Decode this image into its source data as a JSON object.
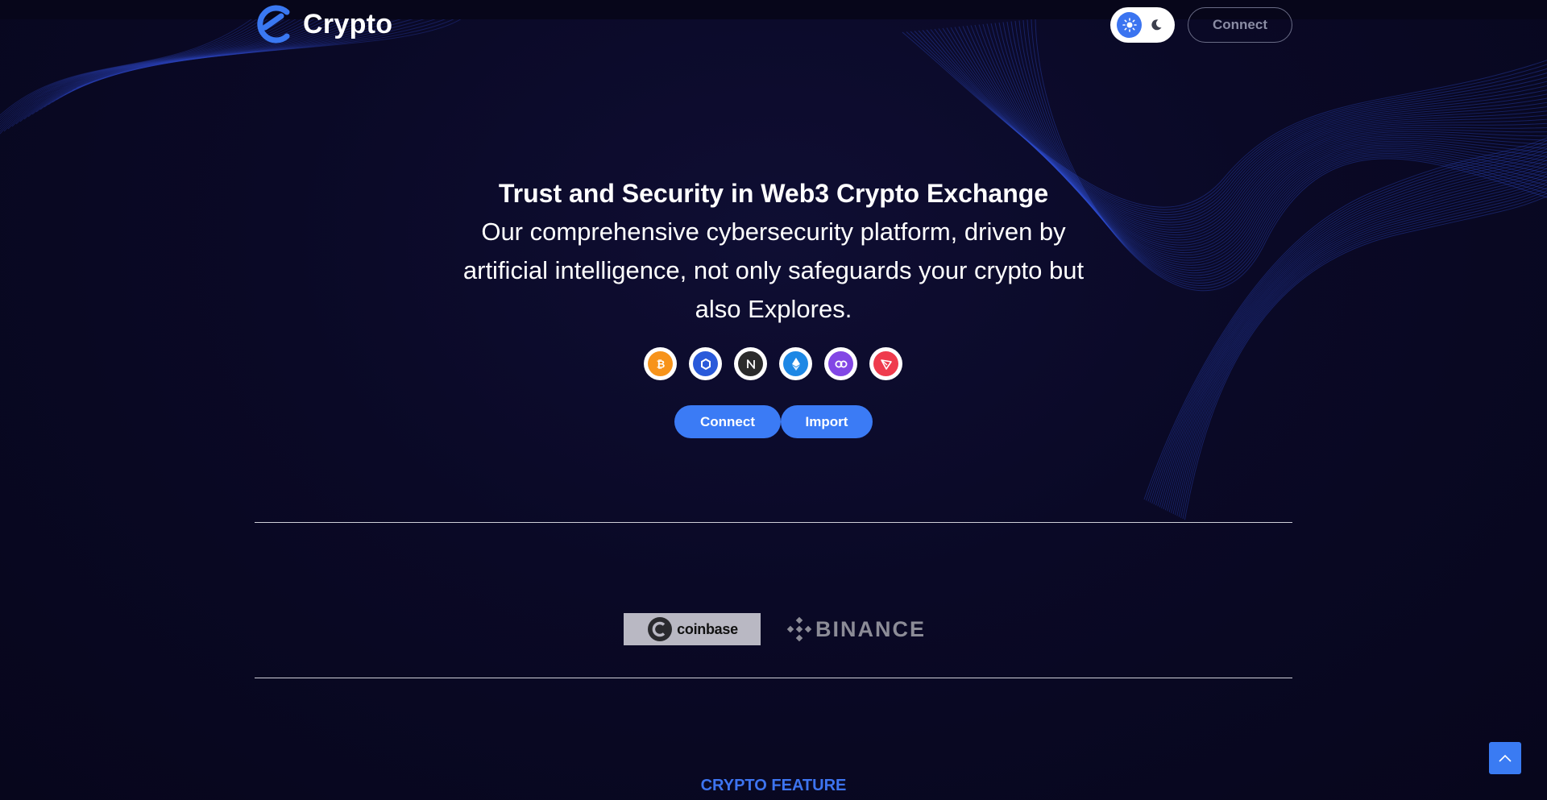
{
  "header": {
    "logo_text": "Crypto",
    "connect_label": "Connect",
    "theme_toggle": {
      "active": "light",
      "icons": [
        "sun-icon",
        "moon-icon"
      ]
    }
  },
  "hero": {
    "title": "Trust and Security in Web3 Crypto Exchange",
    "subtitle": "Our comprehensive cybersecurity platform, driven by artificial intelligence, not only safeguards your crypto but also Explores.",
    "coins": [
      {
        "icon": "bitcoin-icon",
        "color": "#f7931a"
      },
      {
        "icon": "chainlink-icon",
        "color": "#2a5ada"
      },
      {
        "icon": "near-icon",
        "color": "#2b2b2b"
      },
      {
        "icon": "ethereum-icon",
        "color": "#1e88e5"
      },
      {
        "icon": "polygon-icon",
        "color": "#8247e5"
      },
      {
        "icon": "tron-icon",
        "color": "#ef3b4d"
      }
    ],
    "connect_label": "Connect",
    "import_label": "Import"
  },
  "partners": {
    "coinbase_text": "coinbase",
    "binance_text": "BINANCE"
  },
  "features": {
    "label": "CRYPTO FEATURE"
  },
  "colors": {
    "accent": "#3b7bf5",
    "background": "#08071f"
  }
}
